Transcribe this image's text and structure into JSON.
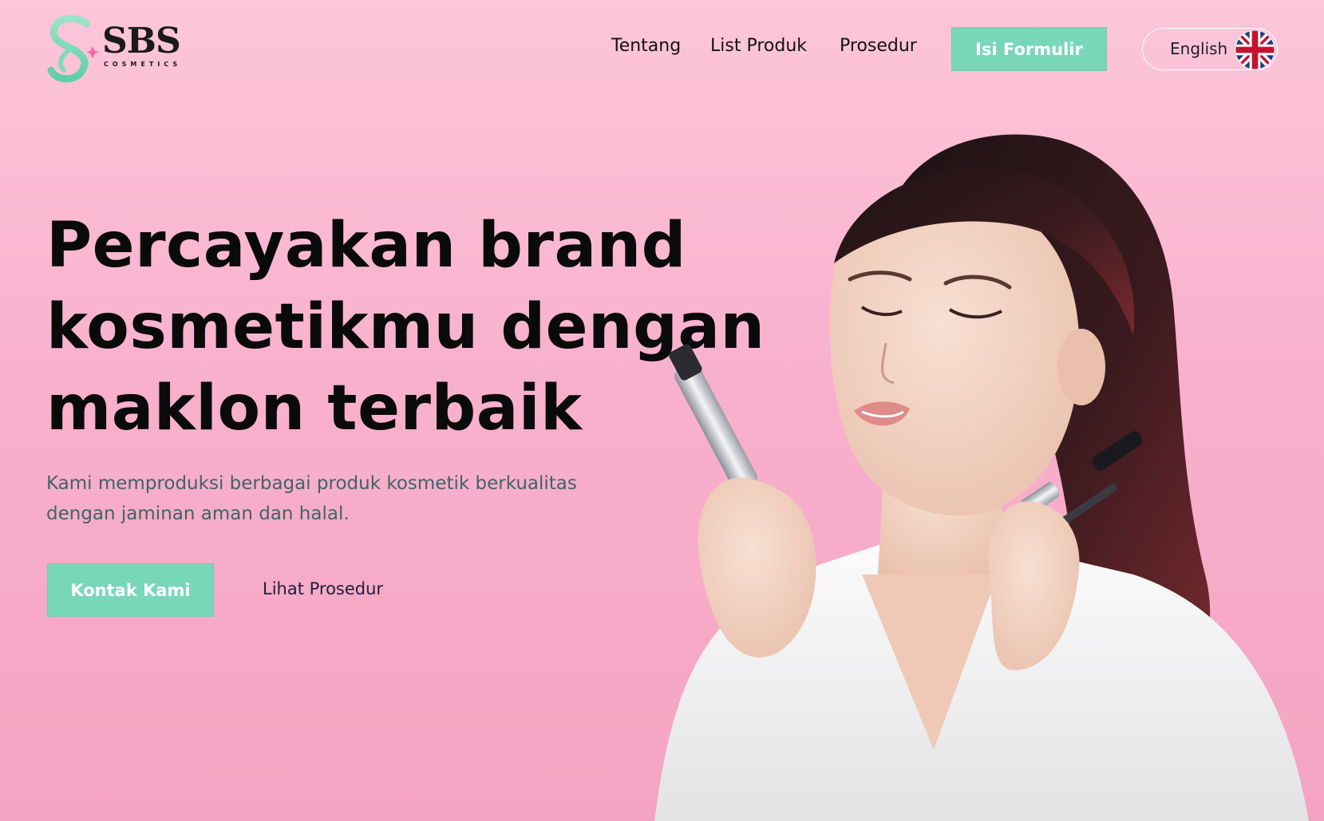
{
  "brand": {
    "name": "SBS",
    "subtitle": "COSMETICS"
  },
  "nav": {
    "items": [
      {
        "label": "Tentang"
      },
      {
        "label": "List Produk"
      },
      {
        "label": "Prosedur"
      }
    ],
    "cta_label": "Isi Formulir",
    "language": {
      "label": "English",
      "flag_icon": "uk-flag-icon"
    }
  },
  "hero": {
    "title_lines": [
      "Percayakan brand",
      "kosmetikmu dengan",
      "maklon terbaik"
    ],
    "subtitle_lines": [
      "Kami memproduksi berbagai produk kosmetik berkualitas",
      "dengan jaminan aman dan halal."
    ],
    "primary_button": "Kontak Kami",
    "secondary_link": "Lihat Prosedur"
  },
  "colors": {
    "accent": "#79d7b9",
    "background": "#f8b1cd",
    "title": "#0a0a0a",
    "subtitle": "#3f6466"
  }
}
